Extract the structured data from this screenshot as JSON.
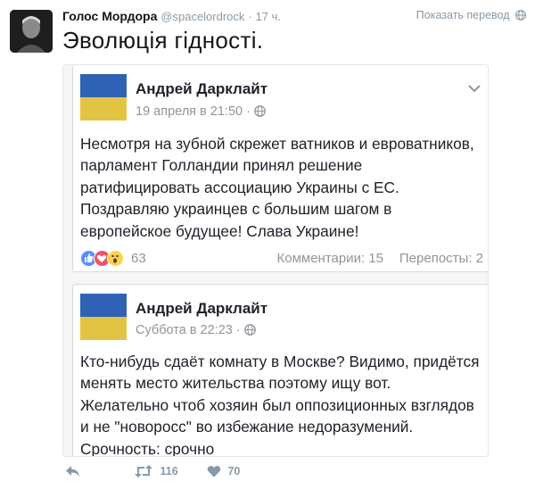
{
  "tweet": {
    "author_name": "Голос Мордора",
    "handle": "@spacelordrock",
    "dot": "·",
    "time": "17 ч.",
    "translate_label": "Показать перевод",
    "text": "Эволюція гідності."
  },
  "posts": [
    {
      "name": "Андрей Дарклайт",
      "date": "19 апреля в 21:50 ·",
      "text": "Несмотря на зубной скрежет ватников и евроватников, парламент Голландии принял решение ратифицировать ассоциацию Украины с ЕС. Поздравляю украинцев с большим шагом в европейское будущее! Слава Украине!",
      "reactions_count": "63",
      "comments": "Комментарии: 15",
      "shares": "Перепосты: 2"
    },
    {
      "name": "Андрей Дарклайт",
      "date": "Суббота в 22:23 ·",
      "text": "Кто-нибудь сдаёт комнату в Москве? Видимо, придётся менять место жительства поэтому ищу вот. Желательно чтоб хозяин был оппозиционных взглядов и не \"новоросс\" во избежание недоразумений. Срочность: срочно"
    }
  ],
  "actions": {
    "retweets": "116",
    "likes": "70"
  },
  "colors": {
    "accent": "#8899a6",
    "flag_blue": "#2f62b4",
    "flag_yellow": "#e2c344"
  }
}
